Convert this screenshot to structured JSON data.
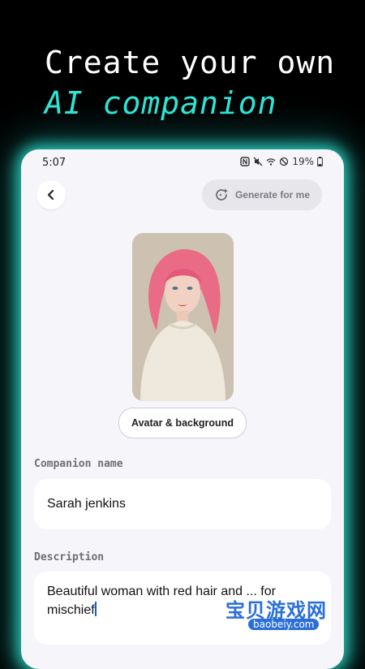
{
  "headline": {
    "line1": "Create your own",
    "line2": "AI companion"
  },
  "status": {
    "time": "5:07",
    "battery": "19%"
  },
  "header": {
    "generate_label": "Generate for me"
  },
  "avatar": {
    "button_label": "Avatar & background"
  },
  "form": {
    "name_label": "Companion name",
    "name_value": "Sarah jenkins",
    "description_label": "Description",
    "description_value": "Beautiful woman with red hair and ... for mischief"
  },
  "watermark": {
    "title": "宝贝游戏网",
    "url": "baobeiy.com"
  },
  "colors": {
    "accent": "#2ee6d6",
    "background": "#000000",
    "panel": "#f6f5f9"
  },
  "icons": [
    "back-arrow-icon",
    "sparkle-generate-icon",
    "wifi-icon",
    "mute-icon",
    "battery-icon"
  ]
}
